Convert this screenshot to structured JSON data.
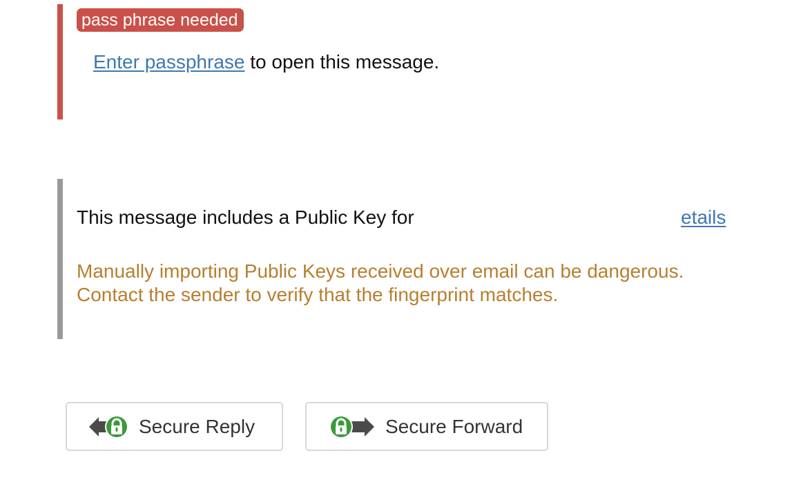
{
  "passphrase_block": {
    "badge": "pass phrase needed",
    "link_text": "Enter passphrase",
    "message_suffix": " to open this message."
  },
  "public_key_block": {
    "message": "This message includes a Public Key for",
    "details_link": "etails",
    "warning_line1": "Manually importing Public Keys received over email can be dangerous.",
    "warning_line2": "Contact the sender to verify that the fingerprint matches."
  },
  "buttons": {
    "secure_reply": "Secure Reply",
    "secure_forward": "Secure Forward"
  },
  "colors": {
    "error_accent": "#c9514a",
    "neutral_accent": "#9a9a9a",
    "link": "#3e78b2",
    "warning_text": "#b77f2f",
    "lock_green": "#3a9a3a"
  }
}
